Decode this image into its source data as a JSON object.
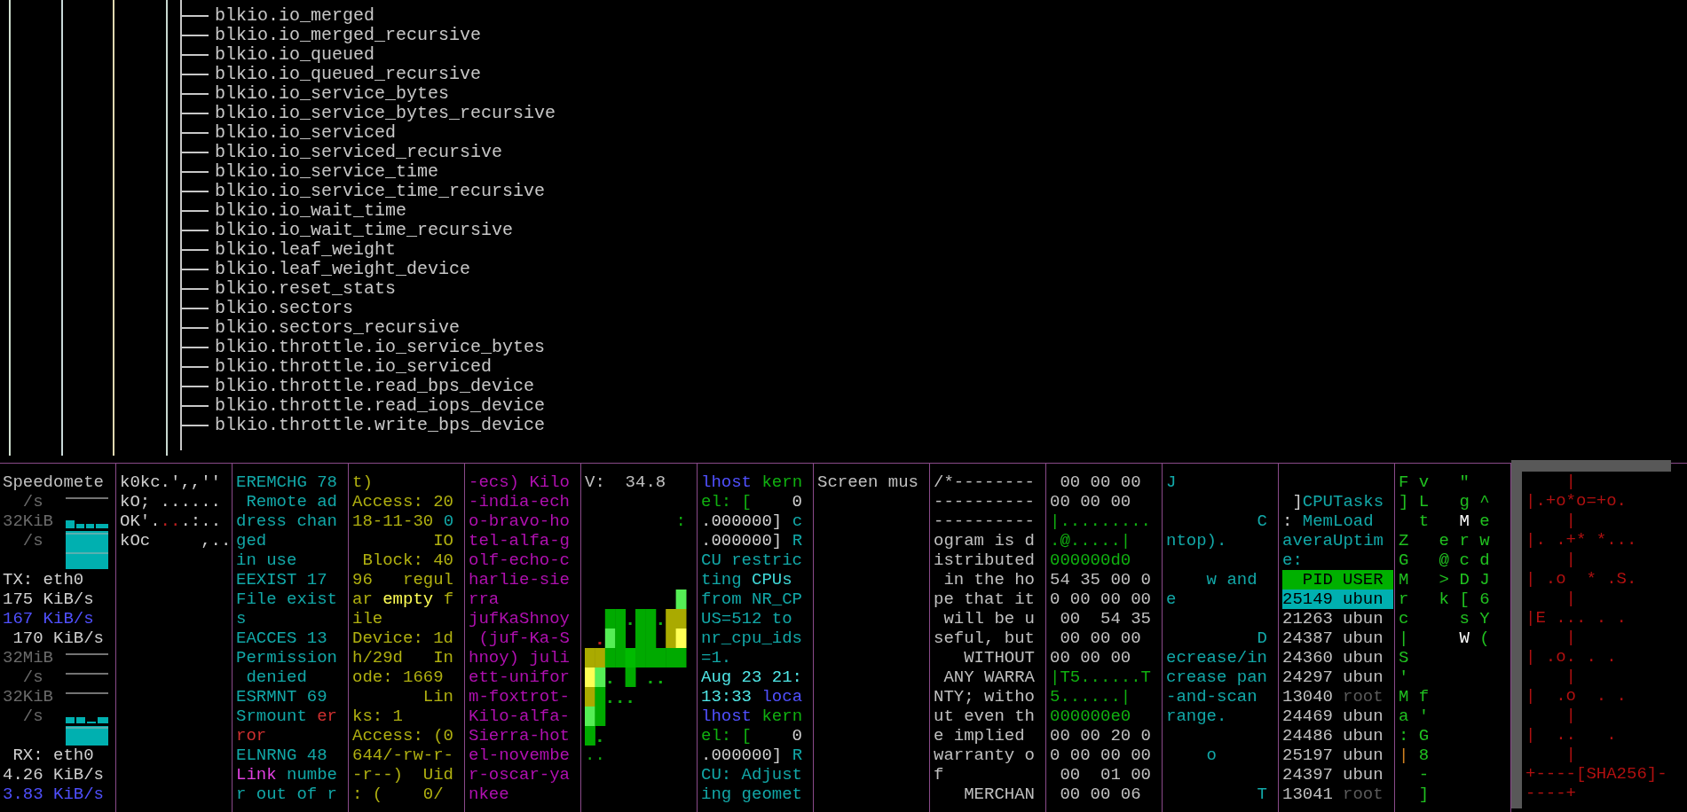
{
  "tree": {
    "items": [
      "blkio.io_merged",
      "blkio.io_merged_recursive",
      "blkio.io_queued",
      "blkio.io_queued_recursive",
      "blkio.io_service_bytes",
      "blkio.io_service_bytes_recursive",
      "blkio.io_serviced",
      "blkio.io_serviced_recursive",
      "blkio.io_service_time",
      "blkio.io_service_time_recursive",
      "blkio.io_wait_time",
      "blkio.io_wait_time_recursive",
      "blkio.leaf_weight",
      "blkio.leaf_weight_device",
      "blkio.reset_stats",
      "blkio.sectors",
      "blkio.sectors_recursive",
      "blkio.throttle.io_service_bytes",
      "blkio.throttle.io_serviced",
      "blkio.throttle.read_bps_device",
      "blkio.throttle.read_iops_device",
      "blkio.throttle.write_bps_device"
    ]
  },
  "panes": [
    {
      "kind": "speedometer",
      "lines": [
        {
          "text": "Speedomete",
          "color": "#c0c0c0"
        },
        {
          "text": "  /s",
          "color": "#6a6a6a"
        },
        {
          "text": "32KiB",
          "color": "#6a6a6a"
        },
        {
          "text": "  /s",
          "color": "#6a6a6a"
        },
        {
          "kind": "blank"
        },
        {
          "text": "TX: eth0",
          "color": "#d0d0d0"
        },
        {
          "text": "175 KiB/s",
          "color": "#d0d0d0"
        },
        {
          "text": "167 KiB/s",
          "color": "#5050ff"
        },
        {
          "text": " 170 KiB/s",
          "color": "#d0d0d0"
        },
        {
          "text": "32MiB",
          "color": "#6a6a6a"
        },
        {
          "text": "  /s",
          "color": "#6a6a6a"
        },
        {
          "text": "32KiB",
          "color": "#6a6a6a"
        },
        {
          "text": "  /s",
          "color": "#6a6a6a"
        },
        {
          "kind": "blank"
        },
        {
          "text": " RX: eth0",
          "color": "#d0d0d0"
        },
        {
          "text": "4.26 KiB/s",
          "color": "#d0d0d0"
        },
        {
          "text": "3.83 KiB/s",
          "color": "#5050ff"
        }
      ]
    },
    {
      "kind": "text",
      "lines": [
        {
          "text": "k0kc.',,''",
          "color": "#d0d0d0"
        },
        {
          "text": "kO; ......",
          "color": "#d0d0d0"
        },
        {
          "segments": [
            {
              "text": "OK'.",
              "color": "#d0d0d0"
            },
            {
              "text": "..",
              "color": "#c02020"
            },
            {
              "text": ".:..",
              "color": "#d0d0d0"
            }
          ]
        },
        {
          "text": "kOc     ,..",
          "color": "#d0d0d0"
        }
      ]
    },
    {
      "kind": "text",
      "lines": [
        {
          "text": "EREMCHG 78",
          "color": "#12a8a8"
        },
        {
          "text": " Remote ad",
          "color": "#12a8a8"
        },
        {
          "text": "dress chan",
          "color": "#12a8a8"
        },
        {
          "text": "ged",
          "color": "#12a8a8"
        },
        {
          "text": "in use",
          "color": "#12a8a8"
        },
        {
          "text": "EEXIST 17",
          "color": "#12a8a8"
        },
        {
          "text": "File exist",
          "color": "#12a8a8"
        },
        {
          "text": "s",
          "color": "#12a8a8"
        },
        {
          "text": "EACCES 13",
          "color": "#12a8a8"
        },
        {
          "text": "Permission",
          "color": "#12a8a8"
        },
        {
          "text": " denied",
          "color": "#12a8a8"
        },
        {
          "text": "ESRMNT 69",
          "color": "#12a8a8"
        },
        {
          "segments": [
            {
              "text": "Srmount ",
              "color": "#12a8a8"
            },
            {
              "text": "er",
              "color": "#d03030"
            }
          ]
        },
        {
          "text": "ror",
          "color": "#d03030"
        },
        {
          "text": "ELNRNG 48",
          "color": "#12a8a8"
        },
        {
          "segments": [
            {
              "text": "Link",
              "color": "#e040e0"
            },
            {
              "text": " numbe",
              "color": "#12a8a8"
            }
          ]
        },
        {
          "text": "r out of r",
          "color": "#12a8a8"
        }
      ]
    },
    {
      "kind": "text",
      "lines": [
        {
          "text": "t)",
          "color": "#b0b010"
        },
        {
          "text": "Access: 20",
          "color": "#b0b010"
        },
        {
          "segments": [
            {
              "text": "18-11-30 ",
              "color": "#b0b010"
            },
            {
              "text": "0",
              "color": "#12a8a8"
            }
          ]
        },
        {
          "text": "        IO",
          "color": "#b0b010"
        },
        {
          "text": " Block: 40",
          "color": "#b0b010"
        },
        {
          "text": "96   regul",
          "color": "#b0b010"
        },
        {
          "segments": [
            {
              "text": "ar ",
              "color": "#b0b010"
            },
            {
              "text": "empty",
              "color": "#ffff55"
            },
            {
              "text": " f",
              "color": "#b0b010"
            }
          ]
        },
        {
          "text": "ile",
          "color": "#b0b010"
        },
        {
          "text": "Device: 1d",
          "color": "#b0b010"
        },
        {
          "text": "h/29d   In",
          "color": "#b0b010"
        },
        {
          "text": "ode: 1669",
          "color": "#b0b010"
        },
        {
          "text": "       Lin",
          "color": "#b0b010"
        },
        {
          "text": "ks: 1",
          "color": "#b0b010"
        },
        {
          "text": "Access: (0",
          "color": "#b0b010"
        },
        {
          "text": "644/-rw-r-",
          "color": "#b0b010"
        },
        {
          "text": "-r--)  Uid",
          "color": "#b0b010"
        },
        {
          "text": ": (    0/",
          "color": "#b0b010"
        }
      ]
    },
    {
      "kind": "text",
      "lines": [
        {
          "text": "-ecs) Kilo",
          "color": "#b010b0"
        },
        {
          "text": "-india-ech",
          "color": "#b010b0"
        },
        {
          "text": "o-bravo-ho",
          "color": "#b010b0"
        },
        {
          "text": "tel-alfa-g",
          "color": "#b010b0"
        },
        {
          "text": "olf-echo-c",
          "color": "#b010b0"
        },
        {
          "text": "harlie-sie",
          "color": "#b010b0"
        },
        {
          "text": "rra",
          "color": "#b010b0"
        },
        {
          "text": "jufKaShnoy",
          "color": "#b010b0"
        },
        {
          "text": " (juf-Ka-S",
          "color": "#b010b0"
        },
        {
          "text": "hnoy) juli",
          "color": "#b010b0"
        },
        {
          "text": "ett-unifor",
          "color": "#b010b0"
        },
        {
          "text": "m-foxtrot-",
          "color": "#b010b0"
        },
        {
          "text": "Kilo-alfa-",
          "color": "#b010b0"
        },
        {
          "text": "Sierra-hot",
          "color": "#b010b0"
        },
        {
          "text": "el-novembe",
          "color": "#b010b0"
        },
        {
          "text": "r-oscar-ya",
          "color": "#b010b0"
        },
        {
          "text": "nkee",
          "color": "#b010b0"
        }
      ]
    },
    {
      "kind": "heatmap",
      "lines": [
        {
          "text": "V:  34.8",
          "color": "#c0c0c0"
        },
        {
          "kind": "blank"
        },
        {
          "text": "         :",
          "color": "#10b010"
        },
        {
          "kind": "blank"
        },
        {
          "kind": "blank"
        },
        {
          "kind": "blank"
        },
        {
          "kind": "blank"
        },
        {
          "kind": "blank"
        },
        {
          "kind": "blank"
        },
        {
          "kind": "blank"
        },
        {
          "kind": "blank"
        },
        {
          "kind": "blank"
        },
        {
          "kind": "blank"
        },
        {
          "kind": "blank"
        },
        {
          "text": "..",
          "color": "#10b010"
        }
      ]
    },
    {
      "kind": "text",
      "lines": [
        {
          "segments": [
            {
              "text": "lhost ",
              "color": "#5050ff"
            },
            {
              "text": "kern",
              "color": "#10b010"
            }
          ]
        },
        {
          "segments": [
            {
              "text": "el: [",
              "color": "#10b010"
            },
            {
              "text": "    0",
              "color": "#d0d0d0"
            }
          ]
        },
        {
          "segments": [
            {
              "text": ".000000] ",
              "color": "#d0d0d0"
            },
            {
              "text": "c",
              "color": "#12a8a8"
            }
          ]
        },
        {
          "segments": [
            {
              "text": ".000000] ",
              "color": "#d0d0d0"
            },
            {
              "text": "R",
              "color": "#12a8a8"
            }
          ]
        },
        {
          "text": "CU restric",
          "color": "#12a8a8"
        },
        {
          "segments": [
            {
              "text": "ting ",
              "color": "#12a8a8"
            },
            {
              "text": "CPUs",
              "color": "#40d8d8"
            }
          ]
        },
        {
          "text": "from NR_CP",
          "color": "#12a8a8"
        },
        {
          "text": "US=512 to",
          "color": "#12a8a8"
        },
        {
          "text": "nr_cpu_ids",
          "color": "#12a8a8"
        },
        {
          "text": "=1.",
          "color": "#12a8a8"
        },
        {
          "text": "Aug 23 21:",
          "color": "#50e8e8"
        },
        {
          "segments": [
            {
              "text": "13:33 ",
              "color": "#50e8e8"
            },
            {
              "text": "loca",
              "color": "#5050ff"
            }
          ]
        },
        {
          "segments": [
            {
              "text": "lhost ",
              "color": "#5050ff"
            },
            {
              "text": "kern",
              "color": "#10b010"
            }
          ]
        },
        {
          "segments": [
            {
              "text": "el: [",
              "color": "#10b010"
            },
            {
              "text": "    0",
              "color": "#d0d0d0"
            }
          ]
        },
        {
          "segments": [
            {
              "text": ".000000] ",
              "color": "#d0d0d0"
            },
            {
              "text": "R",
              "color": "#12a8a8"
            }
          ]
        },
        {
          "text": "CU: Adjust",
          "color": "#12a8a8"
        },
        {
          "text": "ing geomet",
          "color": "#12a8a8"
        }
      ]
    },
    {
      "kind": "text",
      "lines": [
        {
          "text": "Screen mus",
          "color": "#c0c0c0"
        }
      ]
    },
    {
      "kind": "text",
      "lines": [
        {
          "text": "/*--------",
          "color": "#c0c0c0"
        },
        {
          "text": "----------",
          "color": "#c0c0c0"
        },
        {
          "text": "----------",
          "color": "#c0c0c0"
        },
        {
          "text": "ogram is d",
          "color": "#c0c0c0"
        },
        {
          "text": "istributed",
          "color": "#c0c0c0"
        },
        {
          "text": " in the ho",
          "color": "#c0c0c0"
        },
        {
          "text": "pe that it",
          "color": "#c0c0c0"
        },
        {
          "text": " will be u",
          "color": "#c0c0c0"
        },
        {
          "text": "seful, but",
          "color": "#c0c0c0"
        },
        {
          "text": "   WITHOUT",
          "color": "#c0c0c0"
        },
        {
          "text": " ANY WARRA",
          "color": "#c0c0c0"
        },
        {
          "text": "NTY; witho",
          "color": "#c0c0c0"
        },
        {
          "text": "ut even th",
          "color": "#c0c0c0"
        },
        {
          "text": "e implied",
          "color": "#c0c0c0"
        },
        {
          "text": "warranty o",
          "color": "#c0c0c0"
        },
        {
          "text": "f",
          "color": "#c0c0c0"
        },
        {
          "text": "   MERCHAN",
          "color": "#c0c0c0"
        }
      ]
    },
    {
      "kind": "text",
      "lines": [
        {
          "text": " 00 00 00",
          "color": "#c0c0c0"
        },
        {
          "text": "00 00 00",
          "color": "#c0c0c0"
        },
        {
          "text": "|.........",
          "color": "#10b010"
        },
        {
          "text": ".@.....|",
          "color": "#10b010"
        },
        {
          "text": "000000d0",
          "color": "#10b010"
        },
        {
          "text": "54 35 00 0",
          "color": "#c0c0c0"
        },
        {
          "text": "0 00 00 00",
          "color": "#c0c0c0"
        },
        {
          "text": " 00  54 35",
          "color": "#c0c0c0"
        },
        {
          "text": " 00 00 00",
          "color": "#c0c0c0"
        },
        {
          "text": "00 00 00",
          "color": "#c0c0c0"
        },
        {
          "text": "|T5......T",
          "color": "#10b010"
        },
        {
          "text": "5......|",
          "color": "#10b010"
        },
        {
          "text": "000000e0",
          "color": "#10b010"
        },
        {
          "text": "00 00 20 0",
          "color": "#c0c0c0"
        },
        {
          "text": "0 00 00 00",
          "color": "#c0c0c0"
        },
        {
          "text": " 00  01 00",
          "color": "#c0c0c0"
        },
        {
          "text": " 00 00 06",
          "color": "#c0c0c0"
        }
      ]
    },
    {
      "kind": "text",
      "lines": [
        {
          "text": "J",
          "color": "#12a8a8"
        },
        {
          "kind": "blank"
        },
        {
          "text": "         C",
          "color": "#12a8a8"
        },
        {
          "text": "ntop).",
          "color": "#12a8a8"
        },
        {
          "kind": "blank"
        },
        {
          "text": "    w and",
          "color": "#12a8a8"
        },
        {
          "text": "e",
          "color": "#12a8a8"
        },
        {
          "kind": "blank"
        },
        {
          "text": "         D",
          "color": "#12a8a8"
        },
        {
          "text": "ecrease/in",
          "color": "#12a8a8"
        },
        {
          "text": "crease pan",
          "color": "#12a8a8"
        },
        {
          "text": "-and-scan",
          "color": "#12a8a8"
        },
        {
          "text": "range.",
          "color": "#12a8a8"
        },
        {
          "kind": "blank"
        },
        {
          "text": "    o",
          "color": "#12a8a8"
        },
        {
          "kind": "blank"
        },
        {
          "text": "         T",
          "color": "#12a8a8"
        }
      ]
    },
    {
      "kind": "htop",
      "lines": [
        {
          "kind": "blank"
        },
        {
          "segments": [
            {
              "text": " ]",
              "color": "#d0d0d0"
            },
            {
              "text": "CPUTasks",
              "color": "#12a8a8"
            }
          ]
        },
        {
          "segments": [
            {
              "text": ": ",
              "color": "#d0d0d0"
            },
            {
              "text": "MemLoad",
              "color": "#12a8a8"
            }
          ]
        },
        {
          "text": "averaUptim",
          "color": "#12a8a8"
        },
        {
          "text": "e:",
          "color": "#12a8a8"
        }
      ],
      "columns": [
        "PID",
        "USER"
      ],
      "processes": [
        {
          "pid": "25149",
          "user": "ubun",
          "selected": true,
          "dimmed": false
        },
        {
          "pid": "21263",
          "user": "ubun",
          "selected": false,
          "dimmed": false
        },
        {
          "pid": "24387",
          "user": "ubun",
          "selected": false,
          "dimmed": false
        },
        {
          "pid": "24360",
          "user": "ubun",
          "selected": false,
          "dimmed": false
        },
        {
          "pid": "24297",
          "user": "ubun",
          "selected": false,
          "dimmed": false
        },
        {
          "pid": "13040",
          "user": "root",
          "selected": false,
          "dimmed": true
        },
        {
          "pid": "24469",
          "user": "ubun",
          "selected": false,
          "dimmed": false
        },
        {
          "pid": "24486",
          "user": "ubun",
          "selected": false,
          "dimmed": false
        },
        {
          "pid": "25197",
          "user": "ubun",
          "selected": false,
          "dimmed": false
        },
        {
          "pid": "24397",
          "user": "ubun",
          "selected": false,
          "dimmed": false
        },
        {
          "pid": "13041",
          "user": "root",
          "selected": false,
          "dimmed": true
        }
      ]
    },
    {
      "kind": "text",
      "lines": [
        {
          "text": "F v   \"",
          "color": "#20c020"
        },
        {
          "text": "] L   g ^",
          "color": "#20c020"
        },
        {
          "segments": [
            {
              "text": "  t   ",
              "color": "#20c020"
            },
            {
              "text": "M",
              "color": "#ffffff"
            },
            {
              "text": " e",
              "color": "#20c020"
            }
          ]
        },
        {
          "text": "Z   e r w",
          "color": "#20c020"
        },
        {
          "text": "G   @ c d",
          "color": "#20c020"
        },
        {
          "text": "M   > D J",
          "color": "#20c020"
        },
        {
          "text": "r   k [ 6",
          "color": "#20c020"
        },
        {
          "text": "c     s Y",
          "color": "#20c020"
        },
        {
          "segments": [
            {
              "text": "|     ",
              "color": "#20c020"
            },
            {
              "text": "W",
              "color": "#ffffff"
            },
            {
              "text": " (",
              "color": "#20c020"
            }
          ]
        },
        {
          "text": "S",
          "color": "#20c020"
        },
        {
          "text": "'",
          "color": "#20c020"
        },
        {
          "text": "M f",
          "color": "#20c020"
        },
        {
          "text": "a '",
          "color": "#20c020"
        },
        {
          "text": ": G",
          "color": "#20c020"
        },
        {
          "segments": [
            {
              "text": "|",
              "color": "#d08020"
            },
            {
              "text": " 8",
              "color": "#20c020"
            }
          ]
        },
        {
          "text": "  -",
          "color": "#20c020"
        },
        {
          "text": "  ]",
          "color": "#20c020"
        }
      ]
    },
    {
      "kind": "randomart",
      "lines": [
        {
          "text": "    |",
          "color": "#b01010"
        },
        {
          "text": "|.+o*o=+o.",
          "color": "#b01010"
        },
        {
          "text": "    |",
          "color": "#b01010"
        },
        {
          "text": "|. .+* *...",
          "color": "#b01010"
        },
        {
          "text": "    |",
          "color": "#b01010"
        },
        {
          "text": "| .o  * .S.",
          "color": "#b01010"
        },
        {
          "text": "    |",
          "color": "#b01010"
        },
        {
          "text": "|E ... . .",
          "color": "#b01010"
        },
        {
          "text": "    |",
          "color": "#b01010"
        },
        {
          "text": "| .o. . .",
          "color": "#b01010"
        },
        {
          "text": "    |",
          "color": "#b01010"
        },
        {
          "text": "|  .o  . .",
          "color": "#b01010"
        },
        {
          "text": "    |",
          "color": "#b01010"
        },
        {
          "text": "|  ..   .",
          "color": "#b01010"
        },
        {
          "text": "    |",
          "color": "#b01010"
        },
        {
          "text": "+----[SHA256]-",
          "color": "#b01010"
        },
        {
          "text": "----+",
          "color": "#b01010"
        }
      ]
    }
  ]
}
